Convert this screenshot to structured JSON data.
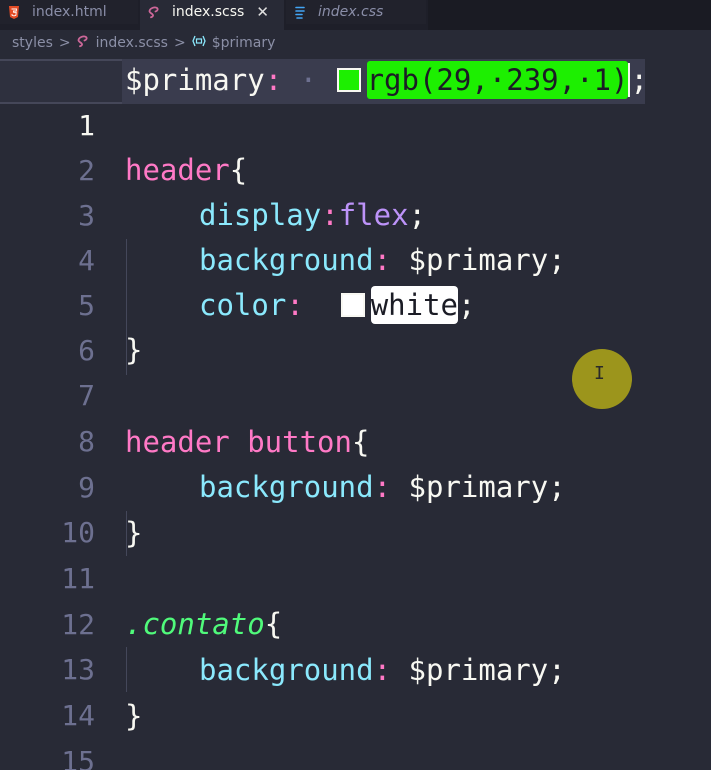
{
  "tabs": [
    {
      "label": "index.html",
      "icon": "html5-icon",
      "color": "#e34c26"
    },
    {
      "label": "index.scss",
      "icon": "sass-icon",
      "color": "#cd6799",
      "active": true,
      "close": "✕"
    },
    {
      "label": "index.css",
      "icon": "css3-icon",
      "color": "#42a5f5"
    }
  ],
  "breadcrumb": {
    "items": [
      "styles",
      "index.scss",
      "$primary"
    ],
    "separator": ">"
  },
  "editor": {
    "lines": [
      {
        "num": "1"
      },
      {
        "num": "2"
      },
      {
        "num": "3"
      },
      {
        "num": "4"
      },
      {
        "num": "5"
      },
      {
        "num": "6"
      },
      {
        "num": "7"
      },
      {
        "num": "8"
      },
      {
        "num": "9"
      },
      {
        "num": "10"
      },
      {
        "num": "11"
      },
      {
        "num": "12"
      },
      {
        "num": "13"
      },
      {
        "num": "14"
      },
      {
        "num": "15"
      }
    ],
    "tokens": {
      "l1_var": "$primary",
      "l1_colon": ":",
      "l1_dot": "·",
      "l1_value": "rgb(29,·239,·1)",
      "l1_semi": ";",
      "l3_sel": "header",
      "l3_brace": "{",
      "l4_prop": "display",
      "l4_colon": ":",
      "l4_val": "flex",
      "l4_semi": ";",
      "l5_prop": "background",
      "l5_colon": ":",
      "l5_val": " $primary",
      "l5_semi": ";",
      "l6_prop": "color",
      "l6_colon": ":",
      "l6_val": "white",
      "l6_semi": ";",
      "l7_brace": "}",
      "l9_sel": "header button",
      "l9_brace": "{",
      "l10_prop": "background",
      "l10_colon": ":",
      "l10_val": " $primary",
      "l10_semi": ";",
      "l11_brace": "}",
      "l13_sel": ".contato",
      "l13_brace": "{",
      "l14_prop": "background",
      "l14_colon": ":",
      "l14_val": " $primary",
      "l14_semi": ";",
      "l15_brace": "}"
    },
    "swatch_green": "#1def01",
    "swatch_white": "#ffffff"
  }
}
